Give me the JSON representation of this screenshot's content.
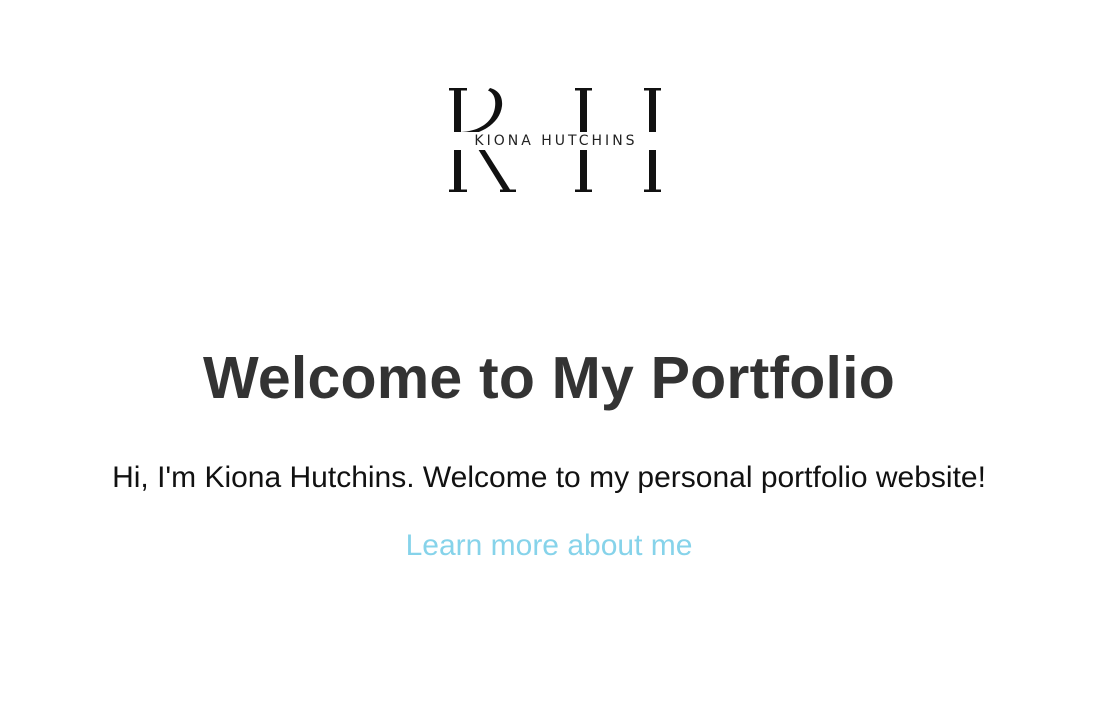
{
  "logo": {
    "monogram": "KH",
    "name": "KIONA HUTCHINS"
  },
  "hero": {
    "title": "Welcome to My Portfolio",
    "intro": "Hi, I'm Kiona Hutchins. Welcome to my personal portfolio website!",
    "link_label": "Learn more about me"
  },
  "colors": {
    "heading": "#333333",
    "body_text": "#111111",
    "link": "#86d3ea",
    "logo": "#111111"
  }
}
